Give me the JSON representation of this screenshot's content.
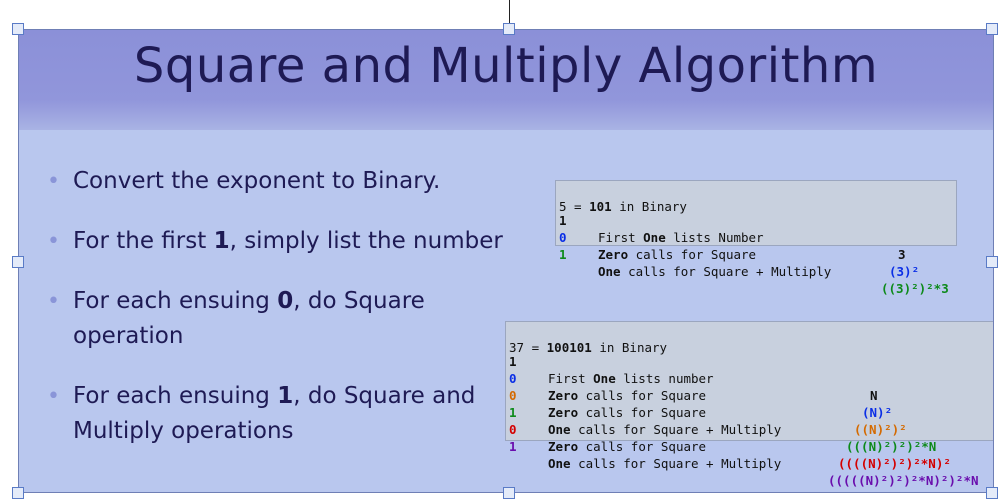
{
  "title": "Square and Multiply Algorithm",
  "colors": {
    "blue": "#0a2ee6",
    "orange": "#d46a00",
    "green": "#0d8a1a",
    "red": "#d40000",
    "purple": "#6a0dad",
    "title": "#1e1a54"
  },
  "bullets": [
    {
      "pre": "Convert the exponent to Binary.",
      "bold": "",
      "post": ""
    },
    {
      "pre": "For the first ",
      "bold": "1",
      "post": ", simply list the number"
    },
    {
      "pre": "For each ensuing ",
      "bold": "0",
      "post": ", do Square operation"
    },
    {
      "pre": "For each ensuing ",
      "bold": "1",
      "post": ", do Square and Multiply operations"
    }
  ],
  "box1": {
    "header_pre": "5 = ",
    "header_bold": "101",
    "header_post": " in Binary",
    "rows": [
      {
        "num": "1",
        "pre": "First ",
        "bold": "One",
        "post": " lists Number",
        "expr": "3"
      },
      {
        "num": "0",
        "pre": "",
        "bold": "Zero",
        "post": " calls for Square",
        "expr": "(3)²"
      },
      {
        "num": "1",
        "pre": "",
        "bold": "One",
        "post": " calls for Square + Multiply",
        "expr": "((3)²)²*3"
      }
    ]
  },
  "box2": {
    "header_pre": "37 = ",
    "header_bold": "100101",
    "header_post": " in Binary",
    "rows": [
      {
        "num": "1",
        "pre": "First ",
        "bold": "One",
        "post": " lists number",
        "expr": "N"
      },
      {
        "num": "0",
        "pre": "",
        "bold": "Zero",
        "post": " calls for Square",
        "expr": "(N)²"
      },
      {
        "num": "0",
        "pre": "",
        "bold": "Zero",
        "post": " calls for Square",
        "expr": "((N)²)²"
      },
      {
        "num": "1",
        "pre": "",
        "bold": "One",
        "post": " calls for Square + Multiply",
        "expr": "(((N)²)²)²*N"
      },
      {
        "num": "0",
        "pre": "",
        "bold": "Zero",
        "post": " calls for Square",
        "expr": "((((N)²)²)²*N)²"
      },
      {
        "num": "1",
        "pre": "",
        "bold": "One",
        "post": " calls for Square + Multiply",
        "expr": "(((((N)²)²)²*N)²)²*N"
      }
    ]
  }
}
